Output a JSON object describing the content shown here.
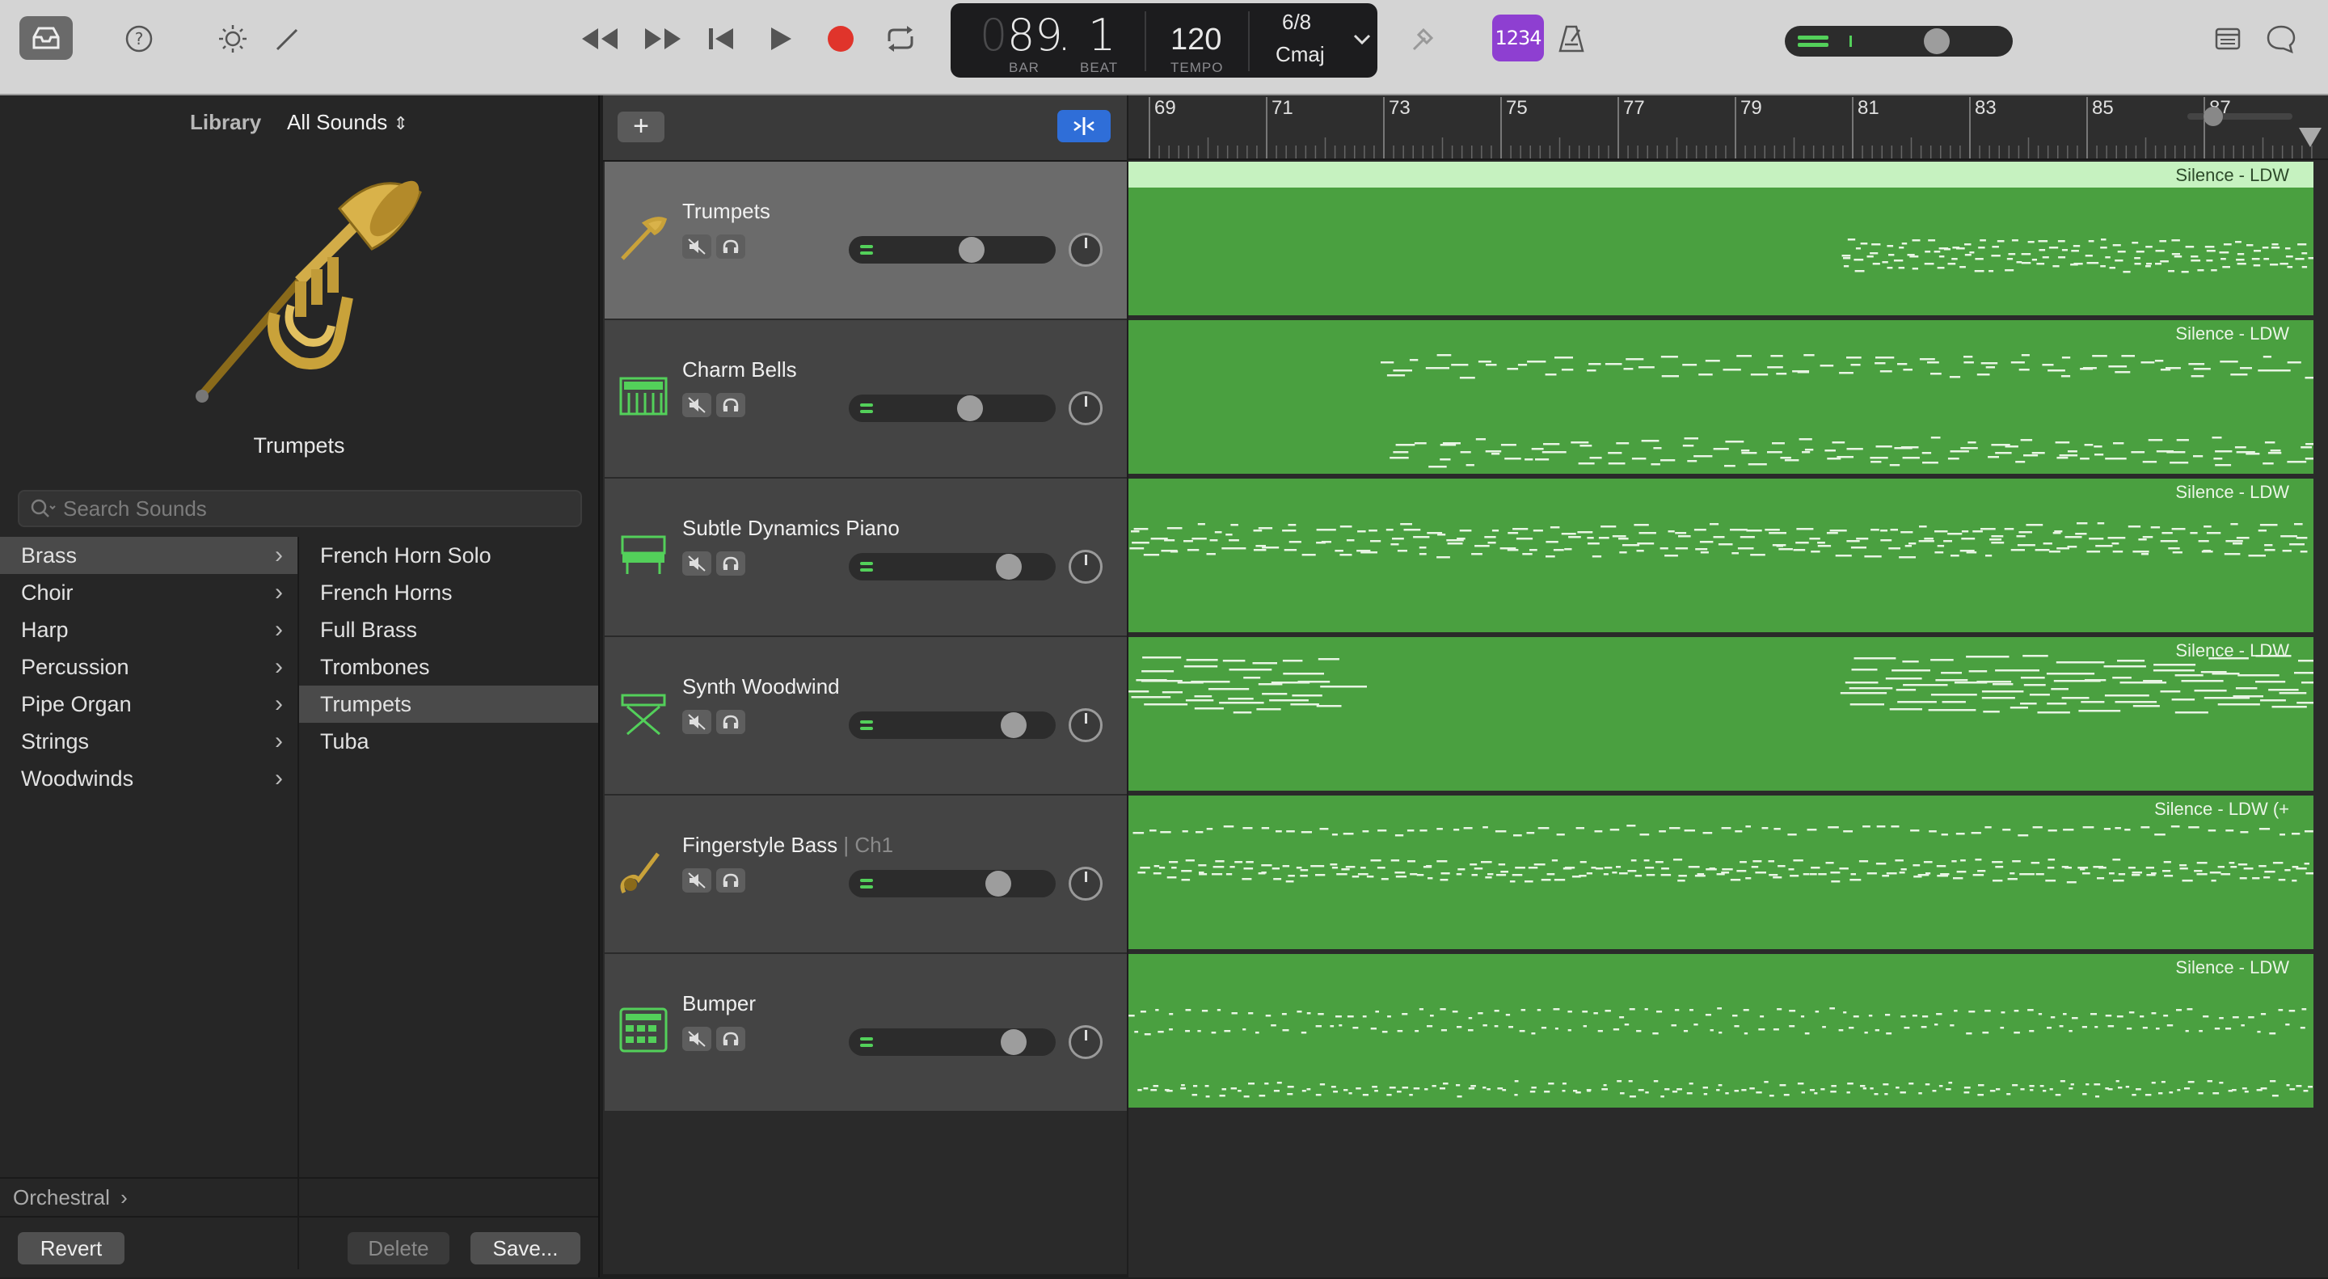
{
  "toolbar": {
    "icons": [
      "library-inbox-icon",
      "help-icon",
      "brightness-icon",
      "pencil-icon",
      "rewind-icon",
      "fast-forward-icon",
      "go-to-start-icon",
      "play-icon",
      "record-icon",
      "cycle-icon",
      "tuner-icon",
      "count-in-icon",
      "metronome-icon",
      "notepad-icon",
      "chat-icon"
    ],
    "count_in_label": "1234",
    "accent": "#8e3fd1",
    "record_color": "#e0342b"
  },
  "lcd": {
    "bar_value": "89",
    "bar_prefix": "0",
    "beat_value": "1",
    "bar_label": "BAR",
    "beat_label": "BEAT",
    "tempo_value": "120",
    "tempo_label": "TEMPO",
    "signature": "6/8",
    "key": "Cmaj"
  },
  "library": {
    "label": "Library",
    "selector": "All Sounds",
    "instrument_name": "Trumpets",
    "search_placeholder": "Search Sounds",
    "categories": [
      {
        "label": "Brass",
        "selected": true
      },
      {
        "label": "Choir",
        "selected": false
      },
      {
        "label": "Harp",
        "selected": false
      },
      {
        "label": "Percussion",
        "selected": false
      },
      {
        "label": "Pipe Organ",
        "selected": false
      },
      {
        "label": "Strings",
        "selected": false
      },
      {
        "label": "Woodwinds",
        "selected": false
      }
    ],
    "patches": [
      {
        "label": "French Horn Solo",
        "selected": false
      },
      {
        "label": "French Horns",
        "selected": false
      },
      {
        "label": "Full Brass",
        "selected": false
      },
      {
        "label": "Trombones",
        "selected": false
      },
      {
        "label": "Trumpets",
        "selected": true
      },
      {
        "label": "Tuba",
        "selected": false
      }
    ],
    "path": "Orchestral",
    "revert_label": "Revert",
    "delete_label": "Delete",
    "save_label": "Save..."
  },
  "tracks": [
    {
      "name": "Trumpets",
      "channel": "",
      "icon": "trumpet-icon",
      "volume": 0.58,
      "selected": true
    },
    {
      "name": "Charm Bells",
      "channel": "",
      "icon": "keyboard-icon",
      "volume": 0.57,
      "selected": false
    },
    {
      "name": "Subtle Dynamics Piano",
      "channel": "",
      "icon": "piano-icon",
      "volume": 0.8,
      "selected": false
    },
    {
      "name": "Synth Woodwind",
      "channel": "",
      "icon": "synth-stand-icon",
      "volume": 0.83,
      "selected": false
    },
    {
      "name": "Fingerstyle Bass",
      "channel": "| Ch1",
      "icon": "bass-guitar-icon",
      "volume": 0.74,
      "selected": false
    },
    {
      "name": "Bumper",
      "channel": "",
      "icon": "drum-machine-icon",
      "volume": 0.83,
      "selected": false
    }
  ],
  "ruler": {
    "bars": [
      "69",
      "71",
      "73",
      "75",
      "77",
      "79",
      "81",
      "83",
      "85",
      "87"
    ]
  },
  "regions": [
    {
      "name": "Silence - LDW"
    },
    {
      "name": "Silence - LDW"
    },
    {
      "name": "Silence - LDW"
    },
    {
      "name": "Silence - LDW"
    },
    {
      "name": "Silence - LDW (+"
    },
    {
      "name": "Silence - LDW"
    }
  ],
  "colors": {
    "region_green": "#4aa040",
    "meter_green": "#53d05a",
    "selected_blue": "#2f6ed8"
  }
}
